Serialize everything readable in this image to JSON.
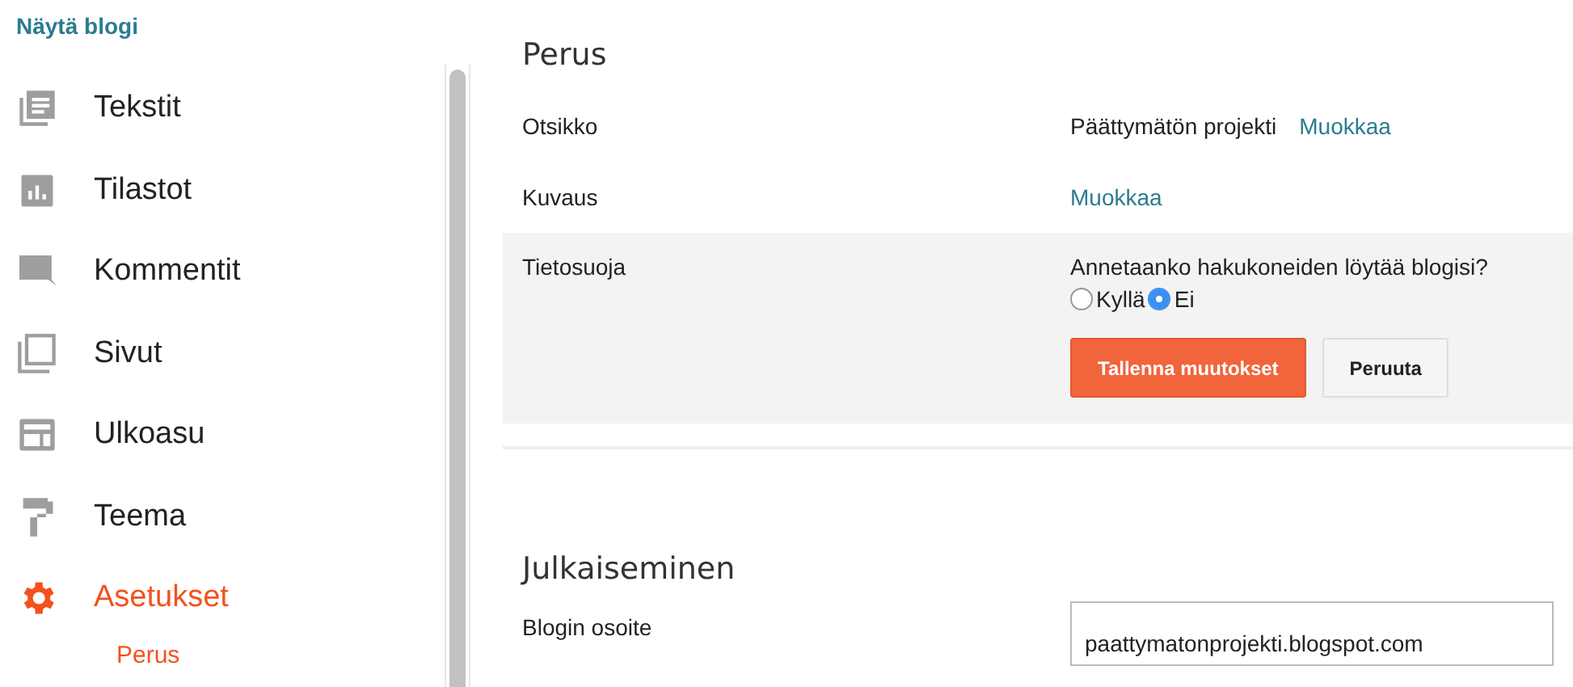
{
  "view_blog_link": "Näytä blogi",
  "sidebar": {
    "items": [
      {
        "kind": "posts",
        "label": "Tekstit",
        "selected": false
      },
      {
        "kind": "stats",
        "label": "Tilastot",
        "selected": false
      },
      {
        "kind": "comments",
        "label": "Kommentit",
        "selected": false
      },
      {
        "kind": "pages",
        "label": "Sivut",
        "selected": false
      },
      {
        "kind": "layout",
        "label": "Ulkoasu",
        "selected": false
      },
      {
        "kind": "theme",
        "label": "Teema",
        "selected": false
      },
      {
        "kind": "settings",
        "label": "Asetukset",
        "selected": true,
        "children": [
          {
            "label": "Perus",
            "selected": true
          }
        ]
      }
    ]
  },
  "sections": [
    {
      "title": "Perus",
      "rows": [
        {
          "kind": "text",
          "label": "Otsikko",
          "value": "Päättymätön projekti",
          "link": "Muokkaa"
        },
        {
          "kind": "text",
          "label": "Kuvaus",
          "link": "Muokkaa"
        },
        {
          "kind": "radio",
          "label": "Tietosuoja",
          "question": "Annetaanko hakukoneiden löytää blogisi?",
          "options": [
            {
              "label": "Kyllä",
              "selected": false
            },
            {
              "label": "Ei",
              "selected": true
            }
          ],
          "buttons": [
            {
              "kind": "primary",
              "label": "Tallenna muutokset"
            },
            {
              "kind": "secondary",
              "label": "Peruuta"
            }
          ]
        }
      ]
    },
    {
      "title": "Julkaiseminen",
      "rows": [
        {
          "kind": "field",
          "label": "Blogin osoite",
          "value": "paattymatonprojekti.blogspot.com"
        }
      ]
    }
  ]
}
